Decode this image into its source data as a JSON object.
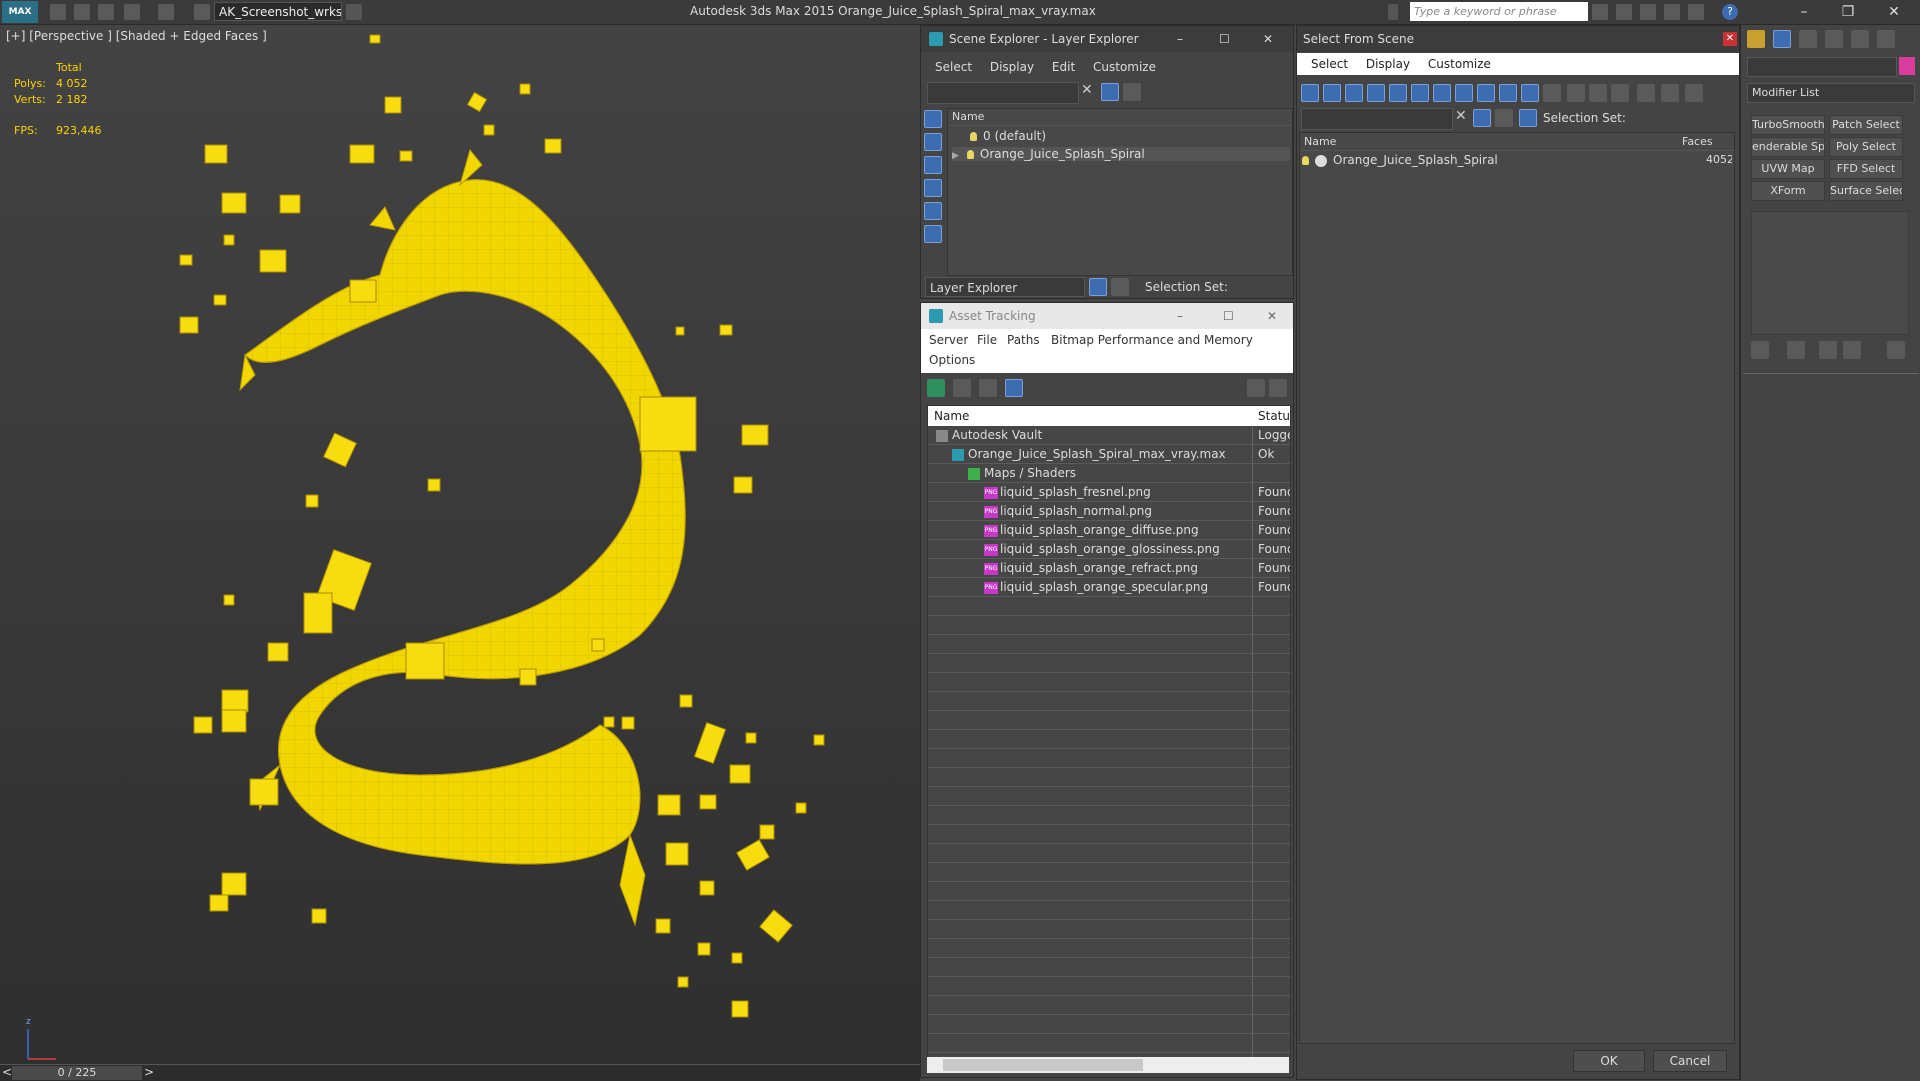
{
  "titlebar": {
    "logo": "MAX",
    "workspace": "AK_Screenshot_wrksp",
    "app_title": "Autodesk 3ds Max  2015    Orange_Juice_Splash_Spiral_max_vray.max",
    "search_placeholder": "Type a keyword or phrase",
    "help": "?",
    "minimize": "–",
    "restore": "❐",
    "close": "✕"
  },
  "viewport": {
    "label": "[+] [Perspective ] [Shaded + Edged Faces ]",
    "stats": {
      "total_label": "Total",
      "polys_label": "Polys:",
      "polys_value": "4 052",
      "verts_label": "Verts:",
      "verts_value": "2 182",
      "fps_label": "FPS:",
      "fps_value": "923,446"
    },
    "axis_z": "z",
    "object_color": "#f2d600"
  },
  "timeline": {
    "left_arrow": "<",
    "frame": "0 / 225",
    "right_arrow": ">"
  },
  "scene_explorer": {
    "title": "Scene Explorer - Layer Explorer",
    "menu": [
      "Select",
      "Display",
      "Edit",
      "Customize"
    ],
    "column_name": "Name",
    "rows": [
      "0 (default)",
      "Orange_Juice_Splash_Spiral"
    ],
    "footer_mode": "Layer Explorer",
    "selection_set_label": "Selection Set:"
  },
  "asset_tracking": {
    "title": "Asset Tracking",
    "menu": [
      "Server",
      "File",
      "Paths",
      "Bitmap Performance and Memory",
      "Options"
    ],
    "col_name": "Name",
    "col_status": "Status",
    "rows": [
      {
        "name": "Autodesk Vault",
        "status": "Logged",
        "indent": 0,
        "icon": "vault"
      },
      {
        "name": "Orange_Juice_Splash_Spiral_max_vray.max",
        "status": "Ok",
        "indent": 1,
        "icon": "max"
      },
      {
        "name": "Maps / Shaders",
        "status": "",
        "indent": 2,
        "icon": "maps"
      },
      {
        "name": "liquid_splash_fresnel.png",
        "status": "Found",
        "indent": 3,
        "icon": "png"
      },
      {
        "name": "liquid_splash_normal.png",
        "status": "Found",
        "indent": 3,
        "icon": "png"
      },
      {
        "name": "liquid_splash_orange_diffuse.png",
        "status": "Found",
        "indent": 3,
        "icon": "png"
      },
      {
        "name": "liquid_splash_orange_glossiness.png",
        "status": "Found",
        "indent": 3,
        "icon": "png"
      },
      {
        "name": "liquid_splash_orange_refract.png",
        "status": "Found",
        "indent": 3,
        "icon": "png"
      },
      {
        "name": "liquid_splash_orange_specular.png",
        "status": "Found",
        "indent": 3,
        "icon": "png"
      }
    ]
  },
  "select_from_scene": {
    "title": "Select From Scene",
    "menu": [
      "Select",
      "Display",
      "Customize"
    ],
    "selection_set_label": "Selection Set:",
    "col_name": "Name",
    "col_faces": "Faces",
    "rows": [
      {
        "name": "Orange_Juice_Splash_Spiral",
        "faces": "4052"
      }
    ],
    "ok": "OK",
    "cancel": "Cancel"
  },
  "command_panel": {
    "modifier_list": "Modifier List",
    "buttons": [
      "TurboSmooth",
      "Patch Select",
      "enderable Splin",
      "Poly Select",
      "UVW Map",
      "FFD Select",
      "XForm",
      "Surface Select"
    ]
  }
}
